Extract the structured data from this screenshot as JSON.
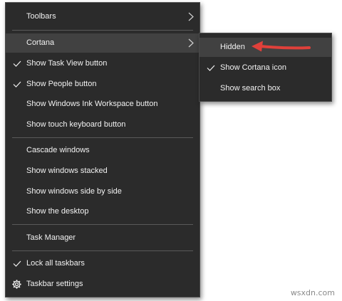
{
  "main_menu": {
    "toolbars_label": "Toolbars",
    "cortana_label": "Cortana",
    "task_view_label": "Show Task View button",
    "people_label": "Show People button",
    "ink_workspace_label": "Show Windows Ink Workspace button",
    "touch_keyboard_label": "Show touch keyboard button",
    "cascade_label": "Cascade windows",
    "stacked_label": "Show windows stacked",
    "side_by_side_label": "Show windows side by side",
    "desktop_label": "Show the desktop",
    "task_manager_label": "Task Manager",
    "lock_label": "Lock all taskbars",
    "settings_label": "Taskbar settings"
  },
  "cortana_submenu": {
    "hidden_label": "Hidden",
    "show_icon_label": "Show Cortana icon",
    "show_search_label": "Show search box"
  },
  "checked": {
    "task_view": true,
    "people": true,
    "lock_all": true,
    "show_cortana_icon": true
  },
  "colors": {
    "menu_background": "#2b2b2b",
    "hover_background": "#414141",
    "text": "#f2f2f2",
    "annotation_arrow": "#e0403a"
  },
  "watermark": "wsxdn.com"
}
